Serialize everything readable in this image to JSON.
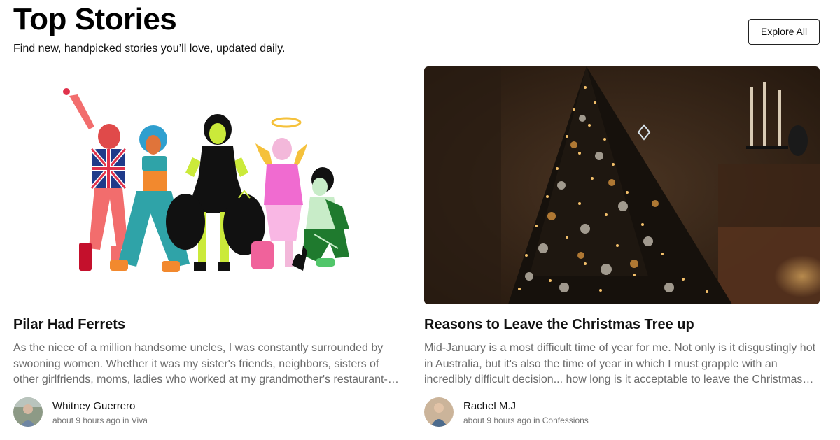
{
  "header": {
    "title": "Top Stories",
    "subtitle": "Find new, handpicked stories you’ll love, updated daily.",
    "explore_label": "Explore All"
  },
  "stories": [
    {
      "title": "Pilar Had Ferrets",
      "excerpt": "As the niece of a million handsome uncles, I was constantly surrounded by swooning women. Whether it was my sister's friends, neighbors, sisters of other girlfriends, moms, ladies who worked at my grandmother's restaurant- none of them could resist my uncles' charms.",
      "author": "Whitney Guerrero",
      "time": "about 9 hours ago in",
      "community": "Viva",
      "image_icon": "illustration-five-women"
    },
    {
      "title": "Reasons to Leave the Christmas Tree up",
      "excerpt": "Mid-January is a most difficult time of year for me. Not only is it disgustingly hot in Australia, but it's also the time of year in which I must grapple with an incredibly difficult decision... how long is it acceptable to leave the Christmas tree up?",
      "author": "Rachel M.J",
      "time": "about 9 hours ago in",
      "community": "Confessions",
      "image_icon": "christmas-tree-photo"
    }
  ],
  "colors": {
    "text": "#111111",
    "muted": "#6b6b6b",
    "meta": "#757575",
    "border": "#222222"
  }
}
